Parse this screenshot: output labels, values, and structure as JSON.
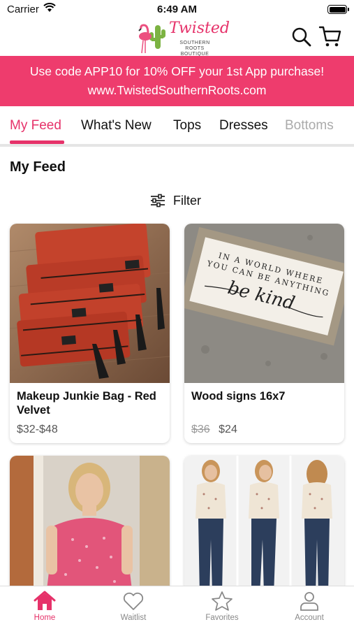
{
  "status_bar": {
    "carrier": "Carrier",
    "time": "6:49 AM"
  },
  "brand": {
    "name": "Twisted",
    "tagline_line1": "SOUTHERN ROOTS",
    "tagline_line2": "BOUTIQUE",
    "accent": "#e6326a",
    "promo_bg": "#ee3c6d"
  },
  "promo": {
    "line1": "Use code APP10 for 10% OFF your 1st App purchase!",
    "line2": "www.TwistedSouthernRoots.com"
  },
  "tabs": [
    {
      "label": "My Feed",
      "active": true
    },
    {
      "label": "What's New"
    },
    {
      "label": "Tops"
    },
    {
      "label": "Dresses"
    },
    {
      "label": "Bottoms"
    }
  ],
  "section_title": "My Feed",
  "filter_label": "Filter",
  "products": [
    {
      "title": "Makeup Junkie Bag - Red Velvet",
      "price": "$32-$48",
      "old_price": ""
    },
    {
      "title": "Wood signs 16x7",
      "price": "$24",
      "old_price": "$36",
      "sign_text_1": "IN A WORLD WHERE",
      "sign_text_2": "YOU CAN BE ANYTHING",
      "sign_text_3": "be kind"
    }
  ],
  "bottom_nav": [
    {
      "label": "Home",
      "icon": "home-icon",
      "active": true
    },
    {
      "label": "Waitlist",
      "icon": "heart-icon"
    },
    {
      "label": "Favorites",
      "icon": "star-icon"
    },
    {
      "label": "Account",
      "icon": "person-icon"
    }
  ]
}
